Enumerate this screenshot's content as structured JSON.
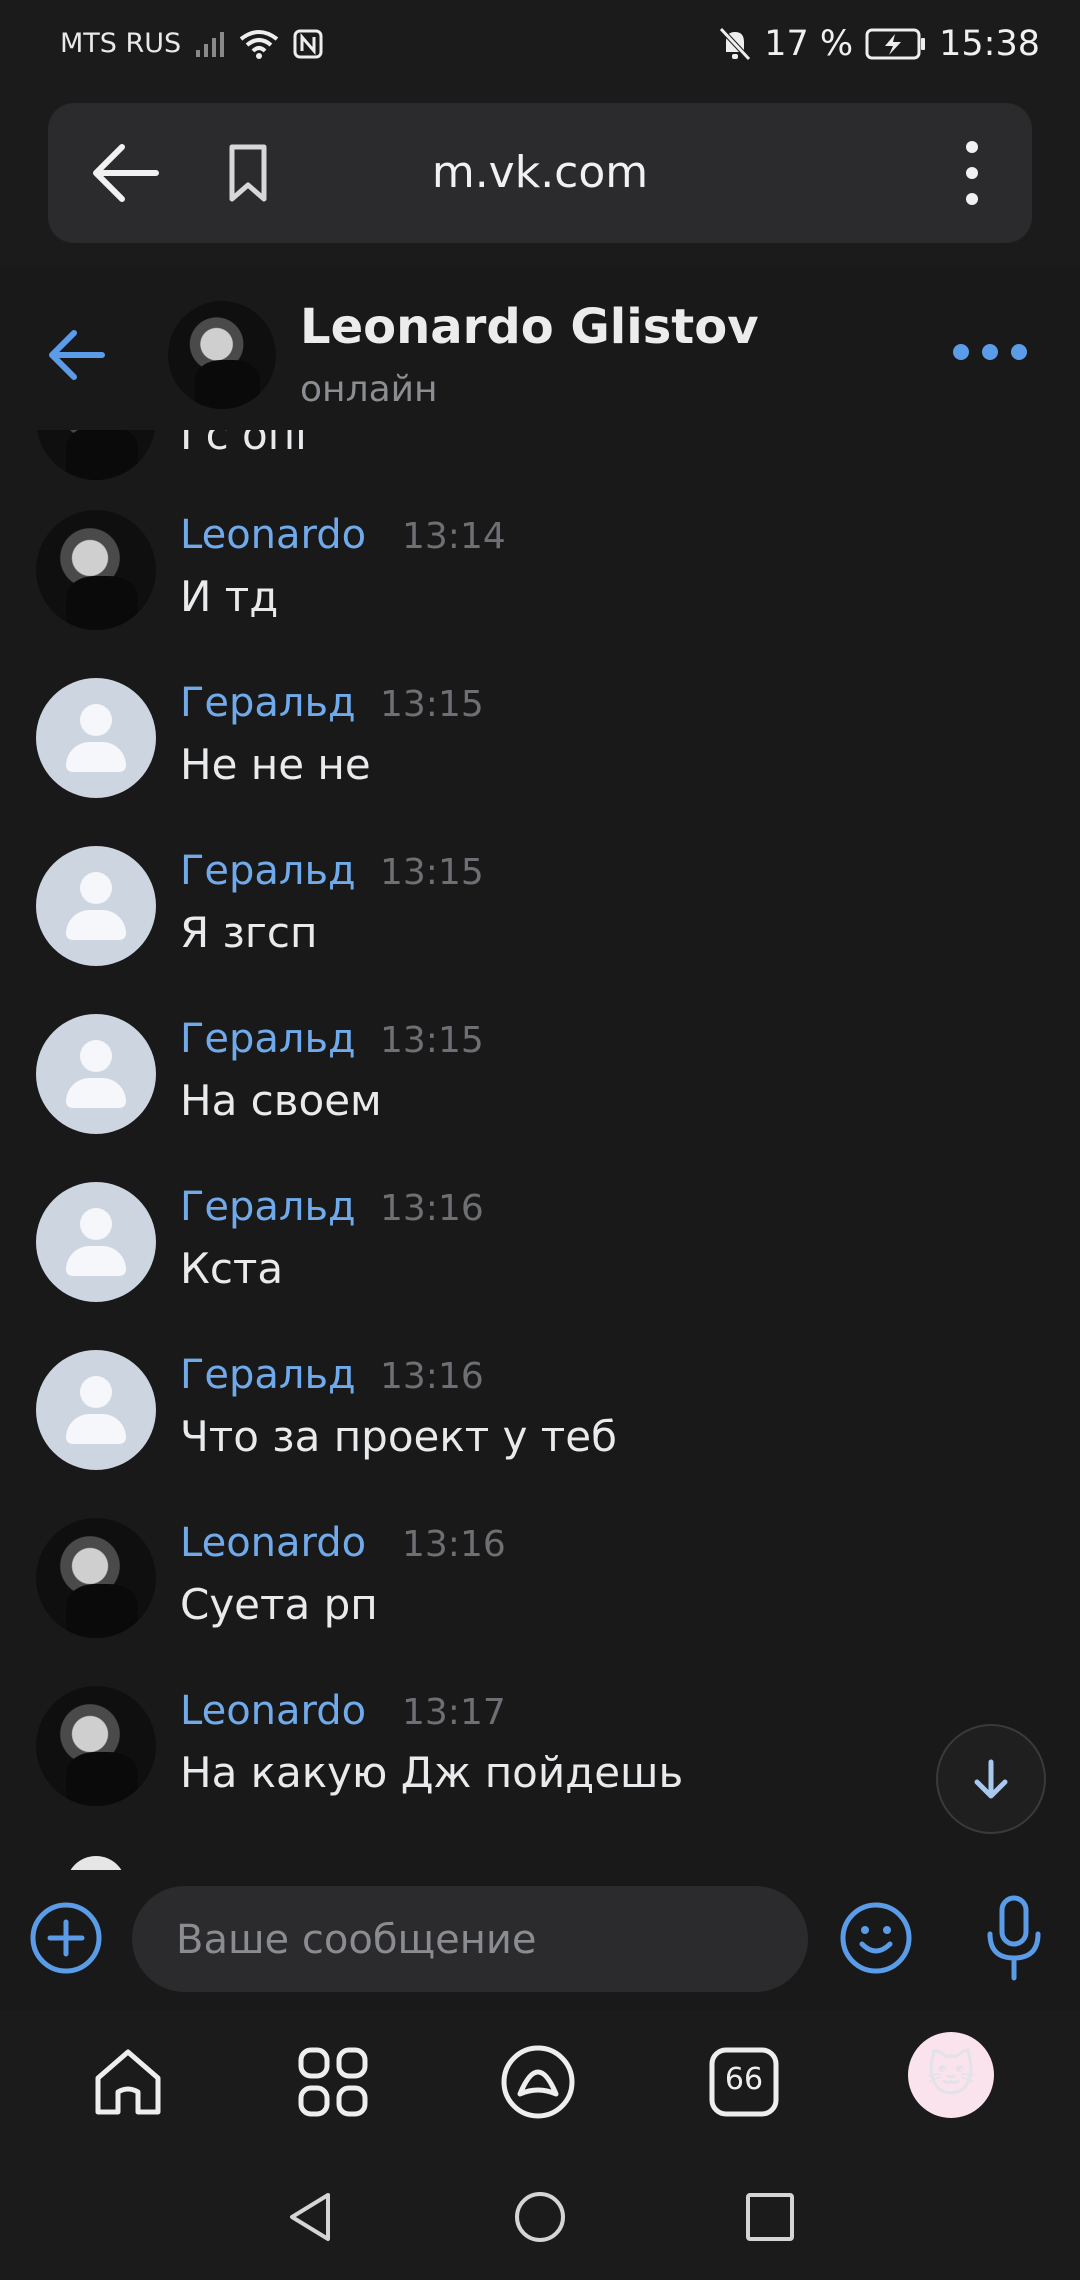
{
  "status_bar": {
    "carrier": "MTS RUS",
    "battery_percent": "17 %",
    "time": "15:38",
    "icons": [
      "signal-icon",
      "wifi-icon",
      "nfc-icon",
      "mute-icon",
      "battery-charging-icon"
    ]
  },
  "browser": {
    "url": "m.vk.com",
    "icons": [
      "back-arrow-icon",
      "bookmark-icon",
      "more-vertical-icon"
    ]
  },
  "chat_header": {
    "name": "Leonardo Glistov",
    "status": "онлайн",
    "icons": [
      "back-arrow-icon",
      "more-horizontal-icon"
    ]
  },
  "partial_message": {
    "text": "Гс опг"
  },
  "messages": [
    {
      "author": "Leonardo",
      "time": "13:14",
      "text": "И тд",
      "avatar": "photo"
    },
    {
      "author": "Геральд",
      "time": "13:15",
      "text": "Не не не",
      "avatar": "default"
    },
    {
      "author": "Геральд",
      "time": "13:15",
      "text": "Я згсп",
      "avatar": "default"
    },
    {
      "author": "Геральд",
      "time": "13:15",
      "text": "На своем",
      "avatar": "default"
    },
    {
      "author": "Геральд",
      "time": "13:16",
      "text": "Кста",
      "avatar": "default"
    },
    {
      "author": "Геральд",
      "time": "13:16",
      "text": "Что за проект у теб",
      "avatar": "default"
    },
    {
      "author": "Leonardo",
      "time": "13:16",
      "text": "Суета рп",
      "avatar": "photo"
    },
    {
      "author": "Leonardo",
      "time": "13:17",
      "text": "На какую Дж пойдешь",
      "avatar": "photo"
    }
  ],
  "composer": {
    "placeholder": "Ваше сообщение",
    "icons": [
      "plus-circle-icon",
      "emoji-icon",
      "microphone-icon",
      "arrow-down-icon"
    ]
  },
  "bottom_nav": {
    "badge_number": "66",
    "icons": [
      "home-icon",
      "apps-grid-icon",
      "alice-icon",
      "messages-icon",
      "cat-avatar-icon"
    ]
  },
  "colors": {
    "background": "#19191a",
    "accent": "#71aaeb",
    "author": "#71aaeb",
    "time": "#6d6f73",
    "input_bg": "#2b2b2d"
  }
}
